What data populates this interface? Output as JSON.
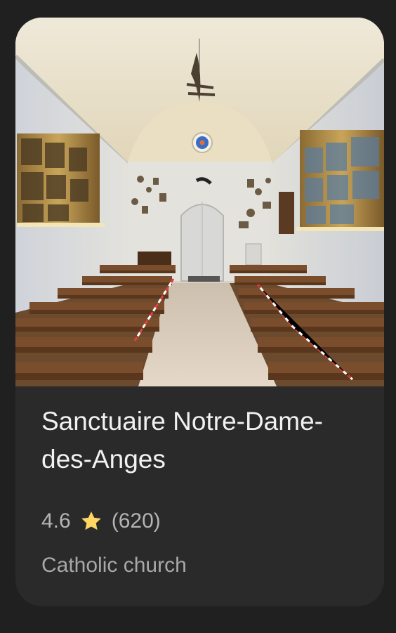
{
  "place": {
    "name": "Sanctuaire Notre-Dame-des-Anges",
    "rating": "4.6",
    "review_count": "(620)",
    "category": "Catholic church"
  },
  "icons": {
    "rating_star": "star-icon"
  },
  "colors": {
    "page_background": "#202020",
    "card_background": "#2a2a2a",
    "title_text": "#f1f1f1",
    "secondary_text": "#b4b4b4",
    "star": "#fdd663"
  }
}
